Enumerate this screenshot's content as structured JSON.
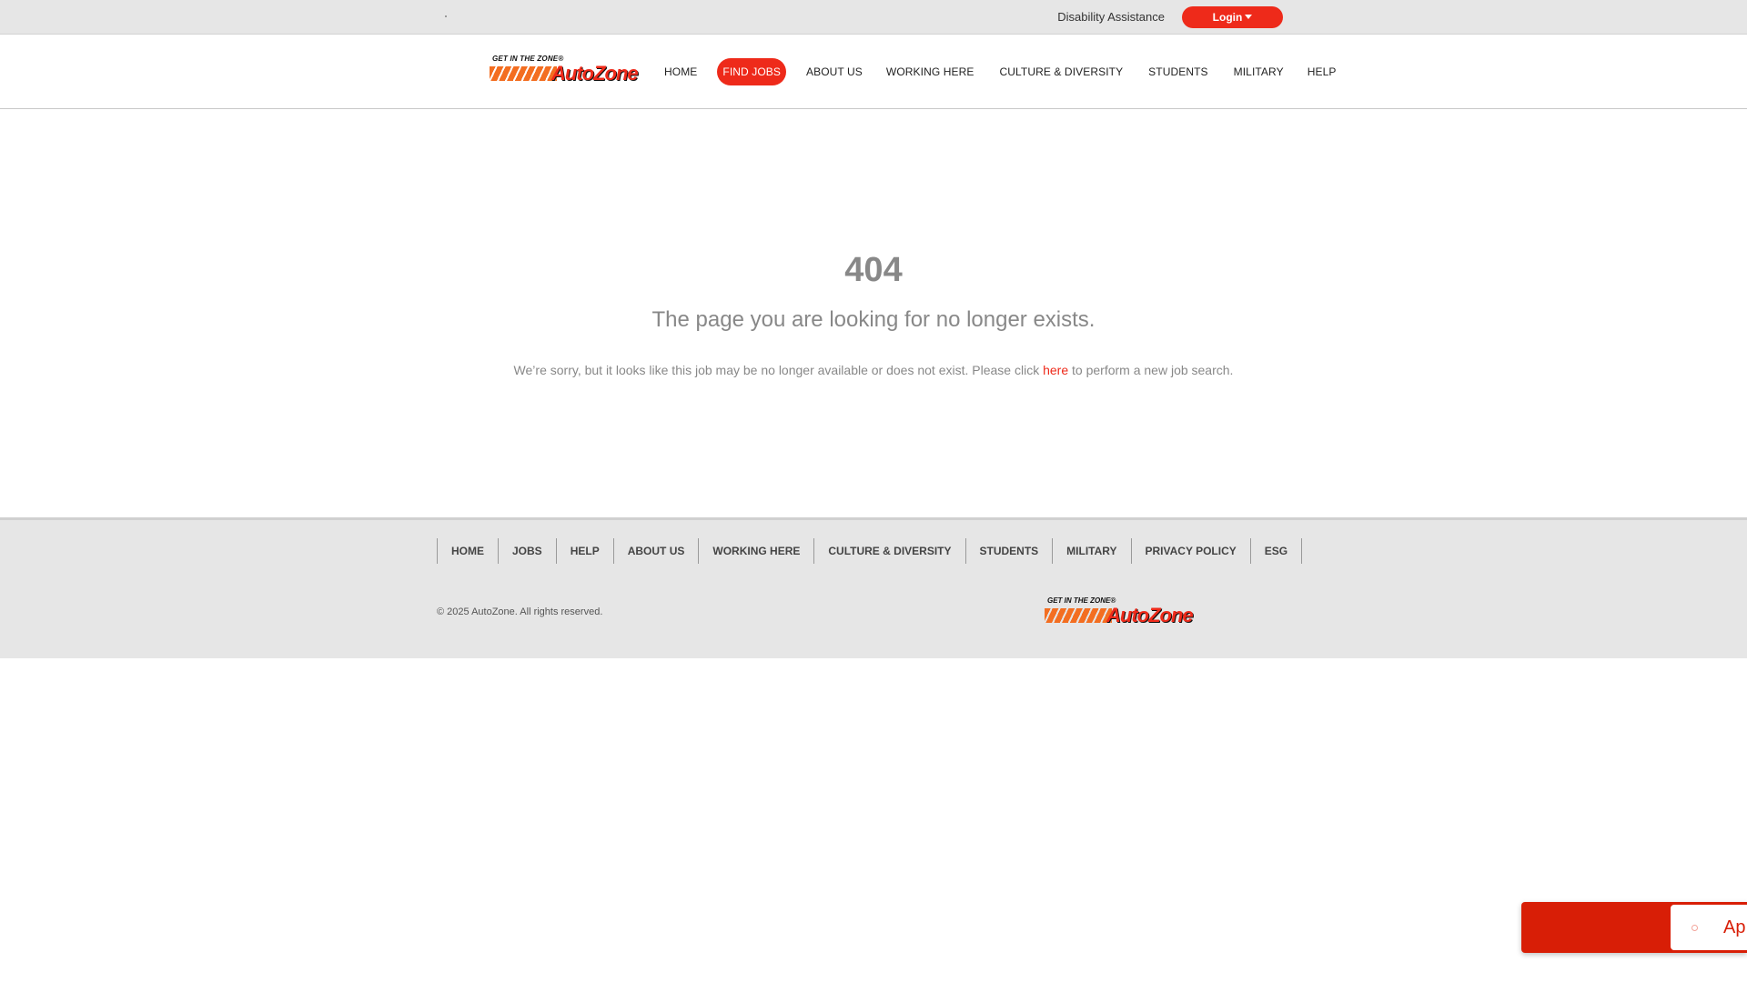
{
  "utility_bar": {
    "disability_label": "Disability Assistance",
    "login_label": "Login"
  },
  "logo": {
    "tagline": "GET IN THE ZONE®",
    "wordmark": "AutoZone"
  },
  "nav": {
    "items": [
      {
        "label": "HOME"
      },
      {
        "label": "FIND JOBS",
        "active": true
      },
      {
        "label": "ABOUT US"
      },
      {
        "label": "WORKING HERE"
      },
      {
        "label": "CULTURE & DIVERSITY"
      },
      {
        "label": "STUDENTS"
      },
      {
        "label": "MILITARY"
      },
      {
        "label": "HELP"
      }
    ]
  },
  "error": {
    "code": "404",
    "title": "The page you are looking for no longer exists.",
    "text_before": "We’re sorry, but it looks like this job may be no longer available or does not exist. Please click ",
    "link_label": "here",
    "text_after": " to perform a new job search."
  },
  "footer": {
    "links": [
      "HOME",
      "JOBS",
      "HELP",
      "ABOUT US",
      "WORKING HERE",
      "CULTURE & DIVERSITY",
      "STUDENTS",
      "MILITARY",
      "PRIVACY POLICY",
      "ESG"
    ],
    "copyright": "© 2025 AutoZone. All rights reserved."
  },
  "apply_widget": {
    "label": "Ap"
  },
  "colors": {
    "brand_red": "#ee2a1a",
    "brand_orange": "#f36e21",
    "widget_red": "#d81e06"
  }
}
